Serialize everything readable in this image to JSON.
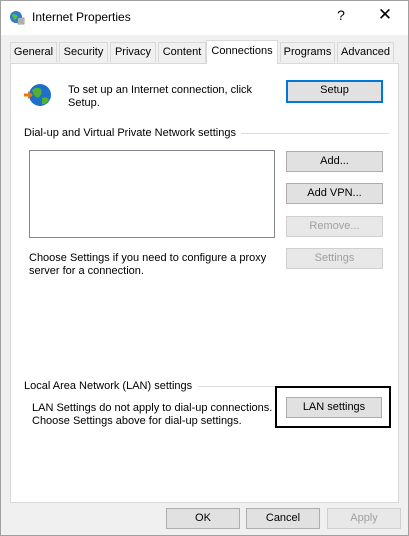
{
  "window": {
    "title": "Internet Properties",
    "help_glyph": "?",
    "close_glyph": "✕"
  },
  "tabs": [
    {
      "label": "General",
      "active": false
    },
    {
      "label": "Security",
      "active": false
    },
    {
      "label": "Privacy",
      "active": false
    },
    {
      "label": "Content",
      "active": false
    },
    {
      "label": "Connections",
      "active": true
    },
    {
      "label": "Programs",
      "active": false
    },
    {
      "label": "Advanced",
      "active": false
    }
  ],
  "setup": {
    "line1": "To set up an Internet connection, click",
    "line2": "Setup.",
    "button": "Setup",
    "icon": "globe-network-icon"
  },
  "dialup": {
    "heading": "Dial-up and Virtual Private Network settings",
    "add_button": "Add...",
    "add_vpn_button": "Add VPN...",
    "remove_button": "Remove...",
    "settings_button": "Settings",
    "note_line1": "Choose Settings if you need to configure a proxy",
    "note_line2": "server for a connection."
  },
  "lan": {
    "heading": "Local Area Network (LAN) settings",
    "note_line1": "LAN Settings do not apply to dial-up connections.",
    "note_line2": "Choose Settings above for dial-up settings.",
    "button": "LAN settings"
  },
  "footer": {
    "ok": "OK",
    "cancel": "Cancel",
    "apply": "Apply"
  },
  "colors": {
    "accent": "#0078d7",
    "disabled_text": "#a0a0a0",
    "dialog_bg": "#f0f0f0"
  }
}
